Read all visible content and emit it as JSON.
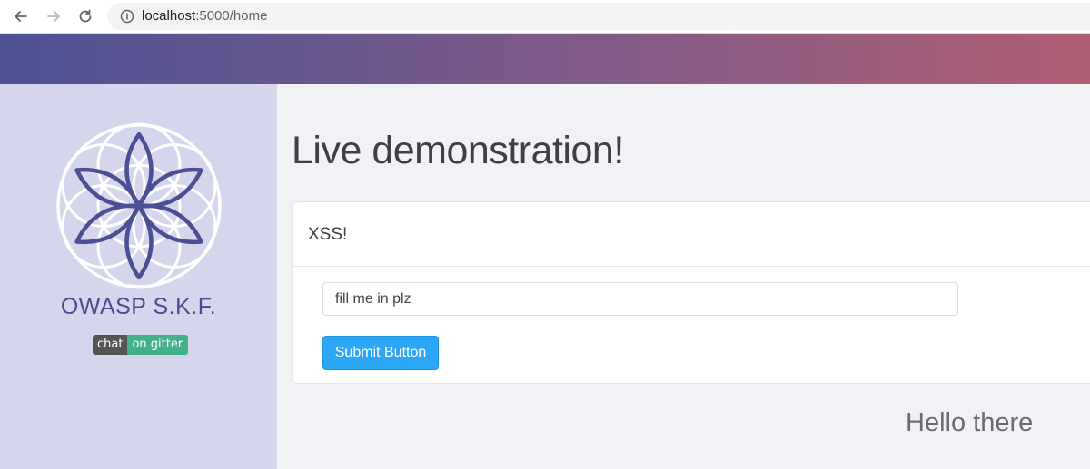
{
  "browser": {
    "url_host": "localhost",
    "url_rest": ":5000/home"
  },
  "sidebar": {
    "brand": "OWASP S.K.F.",
    "badge": {
      "left": "chat",
      "right": "on gitter"
    },
    "logo_color": "#4b4f93"
  },
  "main": {
    "title": "Live demonstration!",
    "card": {
      "title": "XSS!",
      "input_value": "fill me in plz",
      "submit_label": "Submit Button"
    },
    "greeting": "Hello there"
  },
  "colors": {
    "header_gradient": [
      "#4c5293",
      "#b05f75"
    ],
    "sidebar_bg": "#d5d6eb",
    "button": "#2ba7f5"
  }
}
